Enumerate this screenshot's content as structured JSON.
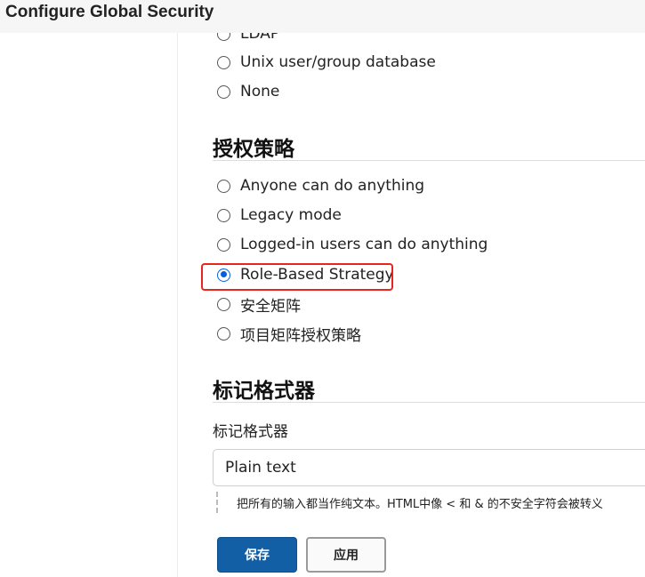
{
  "header": {
    "title": "Configure Global Security"
  },
  "security_realm": {
    "options": [
      {
        "label": "LDAP",
        "checked": false
      },
      {
        "label": "Unix user/group database",
        "checked": false
      },
      {
        "label": "None",
        "checked": false
      }
    ]
  },
  "authorization": {
    "title": "授权策略",
    "options": [
      {
        "label": "Anyone can do anything",
        "checked": false
      },
      {
        "label": "Legacy mode",
        "checked": false
      },
      {
        "label": "Logged-in users can do anything",
        "checked": false
      },
      {
        "label": "Role-Based Strategy",
        "checked": true
      },
      {
        "label": "安全矩阵",
        "checked": false
      },
      {
        "label": "项目矩阵授权策略",
        "checked": false
      }
    ]
  },
  "markup_formatter": {
    "title": "标记格式器",
    "field_label": "标记格式器",
    "selected_value": "Plain text",
    "help_text": "把所有的输入都当作纯文本。HTML中像 < 和 & 的不安全字符会被转义"
  },
  "buttons": {
    "save_label": "保存",
    "apply_label": "应用"
  },
  "colors": {
    "accent": "#135fa6",
    "highlight": "#e8251f",
    "radio_checked": "#0060df"
  }
}
